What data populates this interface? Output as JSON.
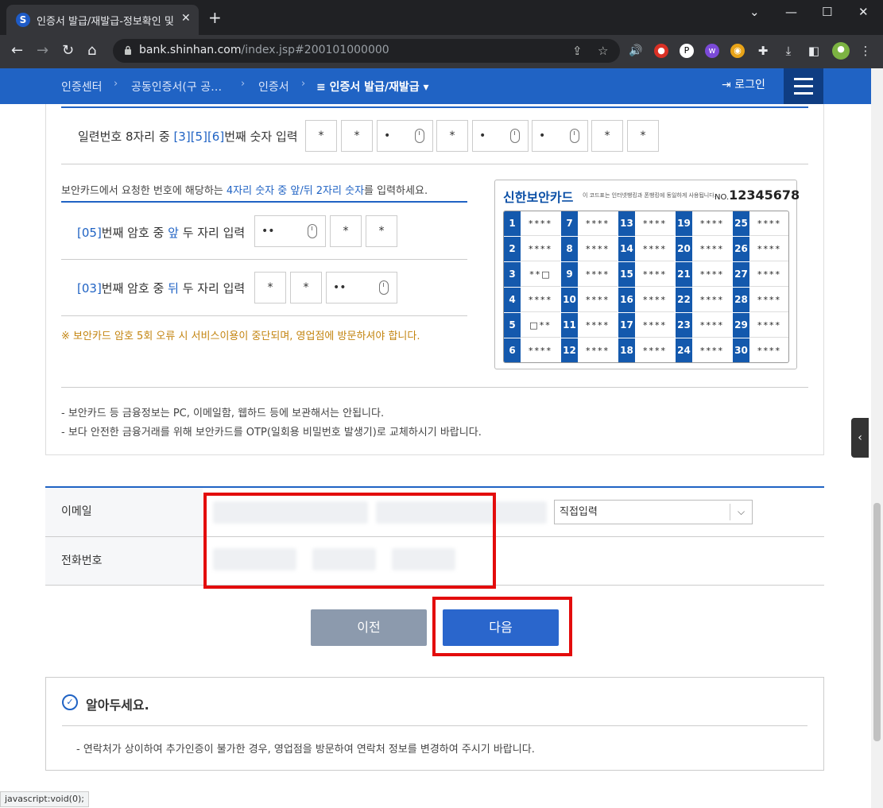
{
  "browser": {
    "tab_title": "인증서 발급/재발급-정보확인 및",
    "url_host": "bank.shinhan.com",
    "url_path": "/index.jsp#200101000000",
    "status_text": "javascript:void(0);"
  },
  "nav": {
    "crumbs": [
      "인증센터",
      "공동인증서(구 공…",
      "인증서",
      "≡ 인증서 발급/재발급 ▾"
    ],
    "login_label": "로그인"
  },
  "serial": {
    "label": "일련번호 8자리 중 ",
    "digits": "[3][5][6]",
    "label_end": "번째 숫자 입력",
    "boxes": [
      "*",
      "*",
      "•",
      "*",
      "•",
      "•",
      "*",
      "*"
    ]
  },
  "seccard_section": {
    "instruction_pre": "보안카드에서 요청한 번호에 해당하는 ",
    "instruction_hl": "4자리 숫자 중 앞/뒤 2자리 숫자",
    "instruction_post": "를 입력하세요.",
    "row1": {
      "num": "[05]",
      "pre": "번째 암호 중 ",
      "pos": "앞",
      "post": " 두 자리 입력",
      "boxes": [
        "••",
        "*",
        "*"
      ]
    },
    "row2": {
      "num": "[03]",
      "pre": "번째 암호 중 ",
      "pos": "뒤",
      "post": " 두 자리 입력",
      "boxes": [
        "*",
        "*",
        "••"
      ]
    },
    "warning": "※ 보안카드 암호 5회 오류 시 서비스이용이 중단되며, 영업점에 방문하셔야 합니다."
  },
  "seccard": {
    "title": "신한보안카드",
    "note": "이 코드표는 인터넷뱅킹과 폰뱅킹에 동일하게 사용됩니다.",
    "no_label": "NO.",
    "no_value": "12345678",
    "cells": [
      [
        "1",
        "****"
      ],
      [
        "7",
        "****"
      ],
      [
        "13",
        "****"
      ],
      [
        "19",
        "****"
      ],
      [
        "25",
        "****"
      ],
      [
        "2",
        "****"
      ],
      [
        "8",
        "****"
      ],
      [
        "14",
        "****"
      ],
      [
        "20",
        "****"
      ],
      [
        "26",
        "****"
      ],
      [
        "3",
        "**□"
      ],
      [
        "9",
        "****"
      ],
      [
        "15",
        "****"
      ],
      [
        "21",
        "****"
      ],
      [
        "27",
        "****"
      ],
      [
        "4",
        "****"
      ],
      [
        "10",
        "****"
      ],
      [
        "16",
        "****"
      ],
      [
        "22",
        "****"
      ],
      [
        "28",
        "****"
      ],
      [
        "5",
        "□**"
      ],
      [
        "11",
        "****"
      ],
      [
        "17",
        "****"
      ],
      [
        "23",
        "****"
      ],
      [
        "29",
        "****"
      ],
      [
        "6",
        "****"
      ],
      [
        "12",
        "****"
      ],
      [
        "18",
        "****"
      ],
      [
        "24",
        "****"
      ],
      [
        "30",
        "****"
      ]
    ]
  },
  "tips": [
    "-  보안카드 등 금융정보는 PC, 이메일함, 웹하드 등에 보관해서는 안됩니다.",
    "-  보다 안전한 금융거래를 위해 보안카드를 OTP(일회용 비밀번호 발생기)로 교체하시기 바랍니다."
  ],
  "contact": {
    "email_label": "이메일",
    "phone_label": "전화번호",
    "domain_select": "직접입력"
  },
  "buttons": {
    "prev": "이전",
    "next": "다음"
  },
  "notice": {
    "title": "알아두세요.",
    "text": "-  연락처가 상이하여 추가인증이 불가한 경우, 영업점을 방문하여 연락처 정보를 변경하여 주시기 바랍니다."
  }
}
